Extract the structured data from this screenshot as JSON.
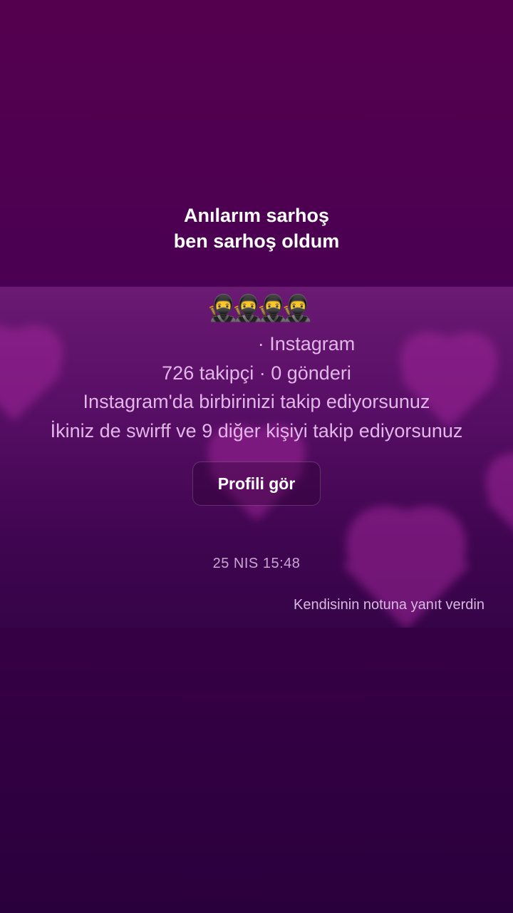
{
  "story": {
    "note_lines": [
      "Anılarım sarhoş",
      "ben sarhoş oldum"
    ]
  },
  "profile": {
    "name_emoji": "🥷🥷🥷🥷",
    "source": "· Instagram",
    "stats": "726 takipçi · 0 gönderi",
    "mutual_follow": "Instagram'da birbirinizi takip ediyorsunuz",
    "common_follow": "İkiniz de swirff ve 9 diğer kişiyi takip ediyorsunuz",
    "view_profile_label": "Profili gör"
  },
  "message": {
    "timestamp": "25 NIS 15:48",
    "reply_note": "Kendisinin notuna yanıt verdin"
  },
  "colors": {
    "background_top": "#55004f",
    "background_bottom": "#2a003c",
    "accent_text": "#e2b6e8",
    "heart": "#a0259a"
  }
}
